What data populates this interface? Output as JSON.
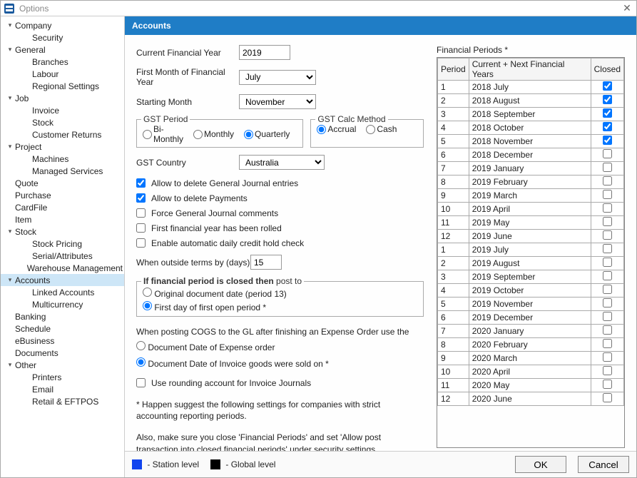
{
  "window": {
    "title": "Options"
  },
  "sidebar": {
    "items": [
      {
        "label": "Company",
        "expandable": true
      },
      {
        "label": "Security",
        "child": true
      },
      {
        "label": "General",
        "expandable": true
      },
      {
        "label": "Branches",
        "child": true
      },
      {
        "label": "Labour",
        "child": true
      },
      {
        "label": "Regional Settings",
        "child": true
      },
      {
        "label": "Job",
        "expandable": true
      },
      {
        "label": "Invoice",
        "child": true
      },
      {
        "label": "Stock",
        "child": true
      },
      {
        "label": "Customer Returns",
        "child": true
      },
      {
        "label": "Project",
        "expandable": true
      },
      {
        "label": "Machines",
        "child": true
      },
      {
        "label": "Managed Services",
        "child": true
      },
      {
        "label": "Quote"
      },
      {
        "label": "Purchase"
      },
      {
        "label": "CardFile"
      },
      {
        "label": "Item"
      },
      {
        "label": "Stock",
        "expandable": true
      },
      {
        "label": "Stock Pricing",
        "child": true
      },
      {
        "label": "Serial/Attributes",
        "child": true
      },
      {
        "label": "Warehouse Management",
        "child": true
      },
      {
        "label": "Accounts",
        "expandable": true,
        "selected": true
      },
      {
        "label": "Linked Accounts",
        "child": true
      },
      {
        "label": "Multicurrency",
        "child": true
      },
      {
        "label": "Banking"
      },
      {
        "label": "Schedule"
      },
      {
        "label": "eBusiness"
      },
      {
        "label": "Documents"
      },
      {
        "label": "Other",
        "expandable": true
      },
      {
        "label": "Printers",
        "child": true
      },
      {
        "label": "Email",
        "child": true
      },
      {
        "label": "Retail & EFTPOS",
        "child": true
      }
    ]
  },
  "header": {
    "title": "Accounts"
  },
  "form": {
    "currentFY_label": "Current Financial Year",
    "currentFY_value": "2019",
    "firstMonth_label": "First Month of Financial Year",
    "firstMonth_value": "July",
    "startingMonth_label": "Starting Month",
    "startingMonth_value": "November",
    "gstPeriod": {
      "legend": "GST Period",
      "biMonthly": "Bi-Monthly",
      "monthly": "Monthly",
      "quarterly": "Quarterly",
      "selected": "quarterly"
    },
    "gstCalc": {
      "legend": "GST Calc Method",
      "accrual": "Accrual",
      "cash": "Cash",
      "selected": "accrual"
    },
    "gstCountry_label": "GST Country",
    "gstCountry_value": "Australia",
    "checks": {
      "allowDeleteGJ": {
        "label": "Allow to delete General Journal entries",
        "checked": true
      },
      "allowDeletePayments": {
        "label": "Allow to delete Payments",
        "checked": true
      },
      "forceGJComments": {
        "label": "Force General Journal comments",
        "checked": false
      },
      "firstFYRolled": {
        "label": "First financial year has been rolled",
        "checked": false
      },
      "autoCreditHold": {
        "label": "Enable automatic daily credit hold check",
        "checked": false
      }
    },
    "outsideTerms_label": "When outside terms by (days)",
    "outsideTerms_value": "15",
    "closedPost": {
      "legendPrefix": "If financial period is closed then",
      "legendSuffix": " post to",
      "originalDate": "Original document date (period 13)",
      "firstOpen": "First day of first open period *",
      "selected": "firstOpen"
    },
    "cogs": {
      "heading": "When posting COGS to the GL after finishing an Expense Order use the",
      "expenseDate": "Document Date of Expense order",
      "invoiceDate": "Document Date of Invoice goods were sold on *",
      "selected": "invoiceDate"
    },
    "useRounding": {
      "label": "Use rounding account for Invoice Journals",
      "checked": false
    },
    "hint1": "* Happen suggest the following settings for companies with strict accounting reporting periods.",
    "hint2": "Also, make sure you close 'Financial Periods' and set 'Allow post transaction into closed financial periods' under security settings."
  },
  "periods": {
    "title": "Financial Periods *",
    "cols": {
      "period": "Period",
      "name": "Current + Next Financial Years",
      "closed": "Closed"
    },
    "rows": [
      {
        "period": "1",
        "name": "2018 July",
        "closed": true
      },
      {
        "period": "2",
        "name": "2018 August",
        "closed": true
      },
      {
        "period": "3",
        "name": "2018 September",
        "closed": true
      },
      {
        "period": "4",
        "name": "2018 October",
        "closed": true
      },
      {
        "period": "5",
        "name": "2018 November",
        "closed": true
      },
      {
        "period": "6",
        "name": "2018 December",
        "closed": false
      },
      {
        "period": "7",
        "name": "2019 January",
        "closed": false
      },
      {
        "period": "8",
        "name": "2019 February",
        "closed": false
      },
      {
        "period": "9",
        "name": "2019 March",
        "closed": false
      },
      {
        "period": "10",
        "name": "2019 April",
        "closed": false
      },
      {
        "period": "11",
        "name": "2019 May",
        "closed": false
      },
      {
        "period": "12",
        "name": "2019 June",
        "closed": false
      },
      {
        "period": "1",
        "name": "2019 July",
        "closed": false
      },
      {
        "period": "2",
        "name": "2019 August",
        "closed": false
      },
      {
        "period": "3",
        "name": "2019 September",
        "closed": false
      },
      {
        "period": "4",
        "name": "2019 October",
        "closed": false
      },
      {
        "period": "5",
        "name": "2019 November",
        "closed": false
      },
      {
        "period": "6",
        "name": "2019 December",
        "closed": false
      },
      {
        "period": "7",
        "name": "2020 January",
        "closed": false
      },
      {
        "period": "8",
        "name": "2020 February",
        "closed": false
      },
      {
        "period": "9",
        "name": "2020 March",
        "closed": false
      },
      {
        "period": "10",
        "name": "2020 April",
        "closed": false
      },
      {
        "period": "11",
        "name": "2020 May",
        "closed": false
      },
      {
        "period": "12",
        "name": "2020 June",
        "closed": false
      }
    ]
  },
  "footer": {
    "stationLevel": " - Station level",
    "globalLevel": " - Global level",
    "ok": "OK",
    "cancel": "Cancel"
  }
}
